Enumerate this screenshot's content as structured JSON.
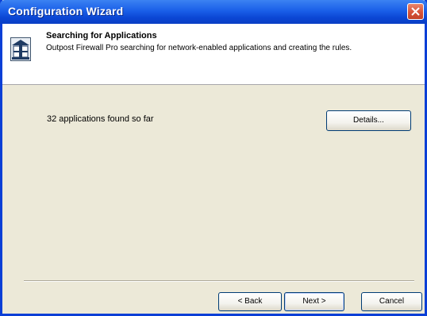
{
  "window": {
    "title": "Configuration Wizard",
    "close_icon": "close-icon"
  },
  "header": {
    "title": "Searching for Applications",
    "subtitle": "Outpost Firewall Pro searching for network-enabled applications and creating the rules.",
    "icon": "firewall-app-icon"
  },
  "main": {
    "status_text": "32 applications found so far",
    "details_button": "Details..."
  },
  "footer": {
    "back_button": "< Back",
    "next_button": "Next >",
    "cancel_button": "Cancel"
  },
  "colors": {
    "titlebar": "#0b46d4",
    "window_body": "#ece9d8",
    "close_button": "#d6533a"
  }
}
